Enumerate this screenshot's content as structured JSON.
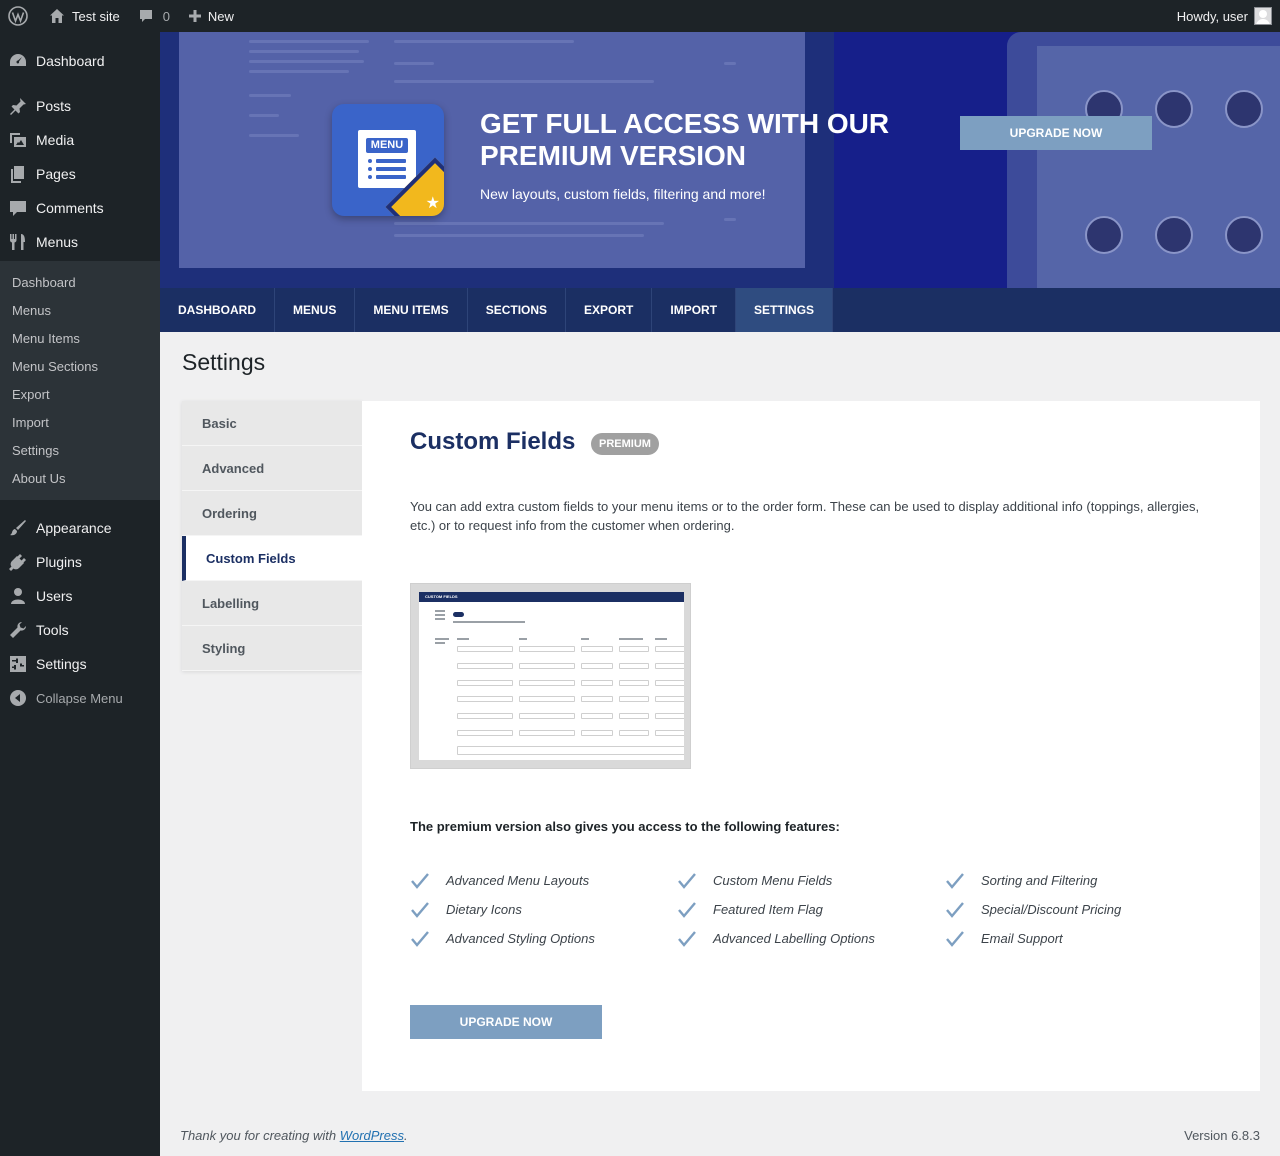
{
  "adminbar": {
    "site_name": "Test site",
    "comments_count": "0",
    "new_label": "New",
    "howdy": "Howdy, user"
  },
  "sidebar": {
    "top_items": [
      {
        "label": "Dashboard",
        "icon": "dashboard-icon"
      },
      {
        "label": "Posts",
        "icon": "pin-icon"
      },
      {
        "label": "Media",
        "icon": "media-icon"
      },
      {
        "label": "Pages",
        "icon": "pages-icon"
      },
      {
        "label": "Comments",
        "icon": "comment-icon"
      },
      {
        "label": "Menus",
        "icon": "fork-knife-icon"
      }
    ],
    "submenu": [
      "Dashboard",
      "Menus",
      "Menu Items",
      "Menu Sections",
      "Export",
      "Import",
      "Settings",
      "About Us"
    ],
    "bottom_items": [
      {
        "label": "Appearance",
        "icon": "brush-icon"
      },
      {
        "label": "Plugins",
        "icon": "plug-icon"
      },
      {
        "label": "Users",
        "icon": "user-icon"
      },
      {
        "label": "Tools",
        "icon": "wrench-icon"
      },
      {
        "label": "Settings",
        "icon": "sliders-icon"
      }
    ],
    "collapse_label": "Collapse Menu"
  },
  "banner": {
    "logo_tag": "MENU",
    "title": "GET FULL ACCESS WITH OUR PREMIUM VERSION",
    "subtitle": "New layouts, custom fields, filtering and more!",
    "button": "UPGRADE NOW"
  },
  "nav_tabs": [
    "DASHBOARD",
    "MENUS",
    "MENU ITEMS",
    "SECTIONS",
    "EXPORT",
    "IMPORT",
    "SETTINGS"
  ],
  "nav_active": "SETTINGS",
  "page_title": "Settings",
  "settings_nav": [
    "Basic",
    "Advanced",
    "Ordering",
    "Custom Fields",
    "Labelling",
    "Styling"
  ],
  "settings_active": "Custom Fields",
  "panel": {
    "title": "Custom Fields",
    "badge": "PREMIUM",
    "description": "You can add extra custom fields to your menu items or to the order form. These can be used to display additional info (toppings, allergies, etc.) or to request info from the customer when ordering.",
    "screenshot_header": "CUSTOM FIELDS",
    "features_intro": "The premium version also gives you access to the following features:",
    "features": [
      "Advanced Menu Layouts",
      "Custom Menu Fields",
      "Sorting and Filtering",
      "Dietary Icons",
      "Featured Item Flag",
      "Special/Discount Pricing",
      "Advanced Styling Options",
      "Advanced Labelling Options",
      "Email Support"
    ],
    "button": "UPGRADE NOW"
  },
  "footer": {
    "thanks_prefix": "Thank you for creating with ",
    "wp_link": "WordPress",
    "thanks_suffix": ".",
    "version": "Version 6.8.3"
  },
  "colors": {
    "nav_bg": "#1b2f63",
    "accent_button": "#7d9fc1",
    "admin_bg": "#1d2327"
  }
}
